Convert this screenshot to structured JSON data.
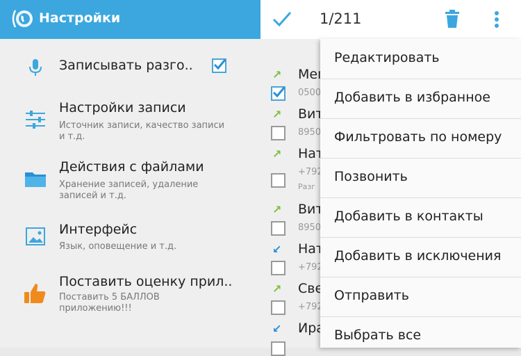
{
  "left": {
    "app_title": "Настройки",
    "items": [
      {
        "title": "Записывать разго..",
        "subtitle": "",
        "icon": "microphone-icon",
        "checked": true
      },
      {
        "title": "Настройки записи",
        "subtitle": "Источник записи, качество записи и т.д.",
        "icon": "sliders-icon"
      },
      {
        "title": "Действия с файлами",
        "subtitle": "Хранение записей, удаление записей и т.д.",
        "icon": "folder-icon"
      },
      {
        "title": "Интерфейс",
        "subtitle": "Язык, оповещение и т.д.",
        "icon": "picture-icon"
      },
      {
        "title": "Поставить оценку прил..",
        "subtitle": "Поставить 5 БАЛЛОВ приложению!!!",
        "icon": "thumbs-up-icon"
      }
    ]
  },
  "right": {
    "count": "1/211",
    "records": [
      {
        "name": "Мег",
        "phone": "0500",
        "direction": "outgoing",
        "checked": true
      },
      {
        "name": "Вит",
        "phone": "8950",
        "direction": "outgoing",
        "checked": false
      },
      {
        "name": "Нат",
        "phone": "+792",
        "extra": "Разг",
        "direction": "outgoing",
        "checked": false
      },
      {
        "name": "Вит",
        "phone": "8950",
        "direction": "outgoing",
        "checked": false
      },
      {
        "name": "Нат",
        "phone": "+792",
        "direction": "incoming",
        "checked": false
      },
      {
        "name": "Све",
        "phone": "+792",
        "direction": "outgoing",
        "checked": false
      },
      {
        "name": "Ира",
        "phone": "",
        "direction": "incoming",
        "checked": false
      }
    ]
  },
  "menu": {
    "items": [
      "Редактировать",
      "Добавить в избранное",
      "Фильтровать по номеру",
      "Позвонить",
      "Добавить в контакты",
      "Добавить в исключения",
      "Отправить",
      "Выбрать все"
    ]
  },
  "colors": {
    "accent": "#3ba7de",
    "outgoing": "#7cbf3b",
    "incoming": "#2b8fd4"
  }
}
